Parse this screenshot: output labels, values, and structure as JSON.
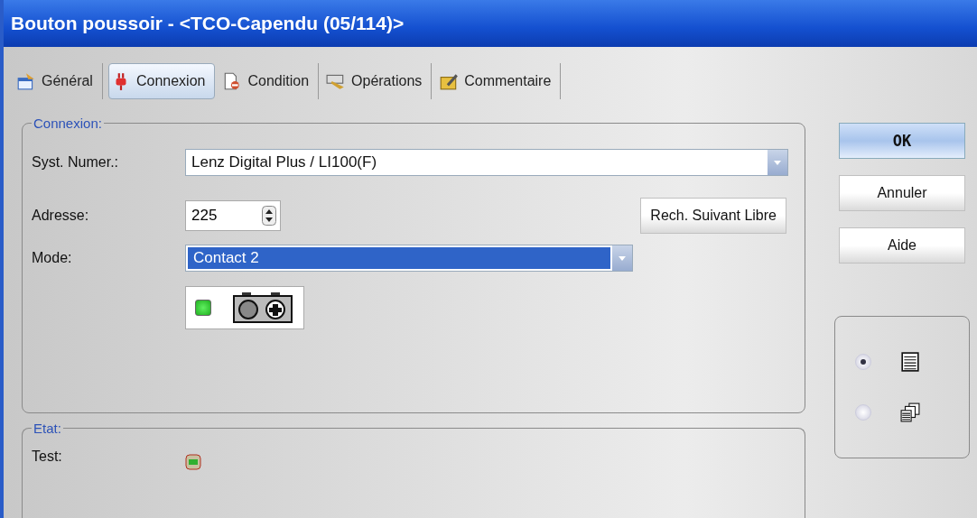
{
  "window": {
    "title": "Bouton poussoir - <TCO-Capendu (05/114)>"
  },
  "tabs": [
    {
      "label": "Général",
      "kind": "general",
      "selected": false
    },
    {
      "label": "Connexion",
      "kind": "plug",
      "selected": true
    },
    {
      "label": "Condition",
      "kind": "condition",
      "selected": false
    },
    {
      "label": "Opérations",
      "kind": "operations",
      "selected": false
    },
    {
      "label": "Commentaire",
      "kind": "comment",
      "selected": false
    }
  ],
  "connexion": {
    "title": "Connexion:",
    "system_label": "Syst. Numer.:",
    "system_value": "Lenz Digital Plus / LI100(F)",
    "address_label": "Adresse:",
    "address_value": "225",
    "search_button": "Rech. Suivant Libre",
    "mode_label": "Mode:",
    "mode_value": "Contact 2",
    "contact_led_on": true
  },
  "etat": {
    "title": "Etat:",
    "test_label": "Test:"
  },
  "buttons": [
    {
      "label": "OK",
      "default": true
    },
    {
      "label": "Annuler",
      "default": false
    },
    {
      "label": "Aide",
      "default": false
    }
  ],
  "view_options": [
    {
      "kind": "single",
      "selected": true
    },
    {
      "kind": "multiple",
      "selected": false
    }
  ]
}
